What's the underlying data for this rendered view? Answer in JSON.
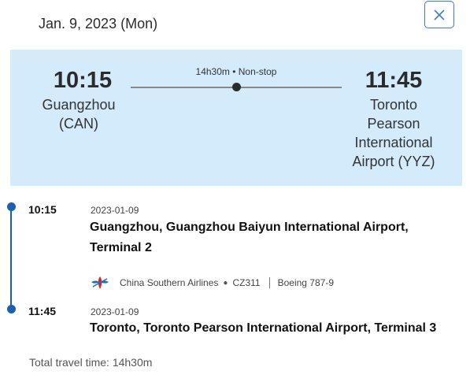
{
  "header": {
    "date": "Jan. 9, 2023 (Mon)",
    "close_icon": "close-icon"
  },
  "summary": {
    "departure_time": "10:15",
    "departure_city": "Guangzhou (CAN)",
    "arrival_time": "11:45",
    "arrival_city": "Toronto Pearson International Airport (YYZ)",
    "duration": "14h30m • Non-stop"
  },
  "segments": [
    {
      "time": "10:15",
      "date": "2023-01-09",
      "place": "Guangzhou, Guangzhou Baiyun International Airport, Terminal 2"
    },
    {
      "time": "11:45",
      "date": "2023-01-09",
      "place": "Toronto, Toronto Pearson International Airport, Terminal 3"
    }
  ],
  "flight": {
    "airline": "China Southern Airlines",
    "separator": "●",
    "flight_number": "CZ311",
    "aircraft": "Boeing 787-9",
    "logo_icon": "china-southern-logo-icon"
  },
  "footer": {
    "total_travel_time": "Total travel time: 14h30m"
  },
  "colors": {
    "summary_bg": "#d3ebfb",
    "accent": "#1a5fb4",
    "close_border": "#3a7bd5",
    "logo_blue": "#1b6fc2",
    "logo_red": "#e2231a"
  }
}
